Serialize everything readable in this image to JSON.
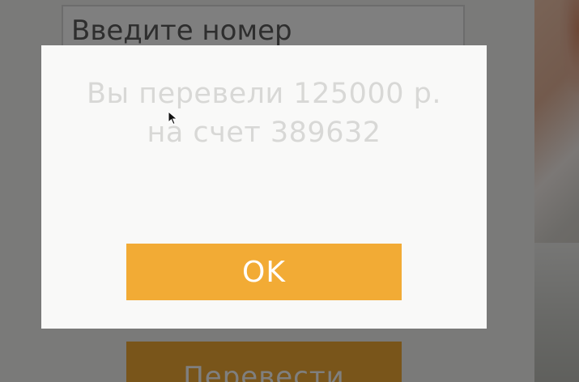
{
  "form": {
    "number_placeholder": "Введите номер",
    "submit_label": "Перевести"
  },
  "modal": {
    "message_line1": "Вы перевели 125000 р.",
    "message_line2": "на счет 389632",
    "ok_label": "OK"
  },
  "colors": {
    "accent": "#f2ab35",
    "modal_background": "#f9f9f8",
    "modal_text": "#d8d8d6"
  },
  "icons": {
    "pointer": "mouse-pointer-icon"
  }
}
